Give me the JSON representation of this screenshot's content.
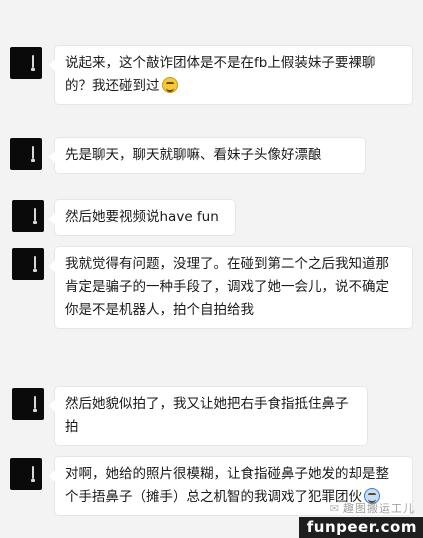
{
  "messages": [
    {
      "text": "说起来，这个敲诈团体是不是在fb上假装妹子要裸聊的？我还碰到过",
      "emoji": "laughing-emoji"
    },
    {
      "text": "先是聊天，聊天就聊嘛、看妹子头像好漂酿"
    },
    {
      "text": "然后她要视频说have fun"
    },
    {
      "text": "我就觉得有问题，没理了。在碰到第二个之后我知道那肯定是骗子的一种手段了，调戏了她一会儿，说不确定你是不是机器人，拍个自拍给我"
    },
    {
      "text": "然后她貌似拍了，我又让她把右手食指抵住鼻子拍"
    },
    {
      "text": "对啊，她给的照片很模糊，让食指碰鼻子她发的却是整个手捂鼻子（摊手）总之机智的我调戏了犯罪团伙",
      "emoji": "grin-emoji"
    }
  ],
  "watermark": {
    "text": "趣图搬运工儿",
    "icon": "wechat-icon"
  },
  "brand": {
    "text": "funpeer.com"
  }
}
